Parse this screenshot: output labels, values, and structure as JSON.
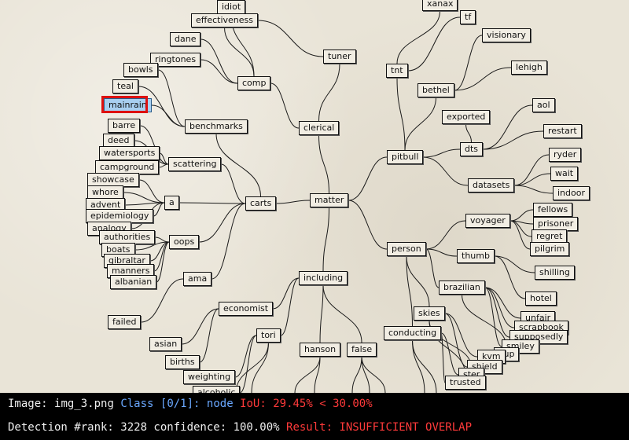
{
  "nodes": [
    {
      "id": "idiot",
      "label": "idiot"
    },
    {
      "id": "effectiveness",
      "label": "effectiveness"
    },
    {
      "id": "dane",
      "label": "dane"
    },
    {
      "id": "ringtones",
      "label": "ringtones"
    },
    {
      "id": "bowls",
      "label": "bowls"
    },
    {
      "id": "comp",
      "label": "comp"
    },
    {
      "id": "teal",
      "label": "teal"
    },
    {
      "id": "mainrain",
      "label": "mainrain",
      "selected": true
    },
    {
      "id": "benchmarks",
      "label": "benchmarks"
    },
    {
      "id": "barre",
      "label": "barre"
    },
    {
      "id": "deed",
      "label": "deed"
    },
    {
      "id": "watersports",
      "label": "watersports"
    },
    {
      "id": "scattering",
      "label": "scattering"
    },
    {
      "id": "campground",
      "label": "campground"
    },
    {
      "id": "showcase",
      "label": "showcase"
    },
    {
      "id": "whore",
      "label": "whore"
    },
    {
      "id": "a",
      "label": "a"
    },
    {
      "id": "advent",
      "label": "advent"
    },
    {
      "id": "epidemiology",
      "label": "epidemiology"
    },
    {
      "id": "analogy",
      "label": "analogy"
    },
    {
      "id": "authorities",
      "label": "authorities"
    },
    {
      "id": "oops",
      "label": "oops"
    },
    {
      "id": "boats",
      "label": "boats"
    },
    {
      "id": "gibraltar",
      "label": "gibraltar"
    },
    {
      "id": "manners",
      "label": "manners"
    },
    {
      "id": "albanian",
      "label": "albanian"
    },
    {
      "id": "ama",
      "label": "ama"
    },
    {
      "id": "failed",
      "label": "failed"
    },
    {
      "id": "carts",
      "label": "carts"
    },
    {
      "id": "clerical",
      "label": "clerical"
    },
    {
      "id": "tuner",
      "label": "tuner"
    },
    {
      "id": "matter",
      "label": "matter"
    },
    {
      "id": "including",
      "label": "including"
    },
    {
      "id": "economist",
      "label": "economist"
    },
    {
      "id": "asian",
      "label": "asian"
    },
    {
      "id": "births",
      "label": "births"
    },
    {
      "id": "weighting",
      "label": "weighting"
    },
    {
      "id": "alcoholic",
      "label": "alcoholic"
    },
    {
      "id": "tori",
      "label": "tori"
    },
    {
      "id": "hanson",
      "label": "hanson"
    },
    {
      "id": "false",
      "label": "false"
    },
    {
      "id": "xanax",
      "label": "xanax"
    },
    {
      "id": "tf",
      "label": "tf"
    },
    {
      "id": "visionary",
      "label": "visionary"
    },
    {
      "id": "tnt",
      "label": "tnt"
    },
    {
      "id": "lehigh",
      "label": "lehigh"
    },
    {
      "id": "bethel",
      "label": "bethel"
    },
    {
      "id": "aol",
      "label": "aol"
    },
    {
      "id": "exported",
      "label": "exported"
    },
    {
      "id": "restart",
      "label": "restart"
    },
    {
      "id": "dts",
      "label": "dts"
    },
    {
      "id": "pitbull",
      "label": "pitbull"
    },
    {
      "id": "ryder",
      "label": "ryder"
    },
    {
      "id": "wait",
      "label": "wait"
    },
    {
      "id": "datasets",
      "label": "datasets"
    },
    {
      "id": "indoor",
      "label": "indoor"
    },
    {
      "id": "fellows",
      "label": "fellows"
    },
    {
      "id": "voyager",
      "label": "voyager"
    },
    {
      "id": "prisoner",
      "label": "prisoner"
    },
    {
      "id": "regret",
      "label": "regret"
    },
    {
      "id": "pilgrim",
      "label": "pilgrim"
    },
    {
      "id": "person",
      "label": "person"
    },
    {
      "id": "thumb",
      "label": "thumb"
    },
    {
      "id": "shilling",
      "label": "shilling"
    },
    {
      "id": "brazilian",
      "label": "brazilian"
    },
    {
      "id": "hotel",
      "label": "hotel"
    },
    {
      "id": "skies",
      "label": "skies"
    },
    {
      "id": "unfair",
      "label": "unfair"
    },
    {
      "id": "scrapbook",
      "label": "scrapbook"
    },
    {
      "id": "supposedly",
      "label": "supposedly"
    },
    {
      "id": "conducting",
      "label": "conducting"
    },
    {
      "id": "smiley",
      "label": "smiley"
    },
    {
      "id": "yup",
      "label": "yup"
    },
    {
      "id": "kvm",
      "label": "kvm"
    },
    {
      "id": "shield",
      "label": "shield"
    },
    {
      "id": "ster",
      "label": "ster"
    },
    {
      "id": "trusted",
      "label": "trusted"
    }
  ],
  "edges": [
    [
      "matter",
      "carts"
    ],
    [
      "matter",
      "clerical"
    ],
    [
      "matter",
      "including"
    ],
    [
      "matter",
      "pitbull"
    ],
    [
      "matter",
      "person"
    ],
    [
      "clerical",
      "comp"
    ],
    [
      "clerical",
      "tuner"
    ],
    [
      "comp",
      "idiot"
    ],
    [
      "comp",
      "effectiveness"
    ],
    [
      "comp",
      "dane"
    ],
    [
      "comp",
      "ringtones"
    ],
    [
      "tuner",
      "effectiveness"
    ],
    [
      "benchmarks",
      "bowls"
    ],
    [
      "benchmarks",
      "teal"
    ],
    [
      "benchmarks",
      "mainrain"
    ],
    [
      "carts",
      "benchmarks"
    ],
    [
      "carts",
      "scattering"
    ],
    [
      "carts",
      "a"
    ],
    [
      "carts",
      "oops"
    ],
    [
      "carts",
      "ama"
    ],
    [
      "scattering",
      "barre"
    ],
    [
      "scattering",
      "deed"
    ],
    [
      "scattering",
      "watersports"
    ],
    [
      "scattering",
      "campground"
    ],
    [
      "a",
      "showcase"
    ],
    [
      "a",
      "whore"
    ],
    [
      "a",
      "advent"
    ],
    [
      "a",
      "epidemiology"
    ],
    [
      "a",
      "analogy"
    ],
    [
      "oops",
      "authorities"
    ],
    [
      "oops",
      "boats"
    ],
    [
      "oops",
      "gibraltar"
    ],
    [
      "oops",
      "manners"
    ],
    [
      "oops",
      "albanian"
    ],
    [
      "ama",
      "failed"
    ],
    [
      "including",
      "economist"
    ],
    [
      "including",
      "tori"
    ],
    [
      "including",
      "hanson"
    ],
    [
      "including",
      "false"
    ],
    [
      "economist",
      "asian"
    ],
    [
      "economist",
      "births"
    ],
    [
      "tori",
      "weighting"
    ],
    [
      "tori",
      "alcoholic"
    ],
    [
      "pitbull",
      "tnt"
    ],
    [
      "pitbull",
      "bethel"
    ],
    [
      "pitbull",
      "dts"
    ],
    [
      "pitbull",
      "datasets"
    ],
    [
      "tnt",
      "xanax"
    ],
    [
      "tnt",
      "tf"
    ],
    [
      "bethel",
      "visionary"
    ],
    [
      "bethel",
      "lehigh"
    ],
    [
      "dts",
      "aol"
    ],
    [
      "dts",
      "exported"
    ],
    [
      "dts",
      "restart"
    ],
    [
      "datasets",
      "ryder"
    ],
    [
      "datasets",
      "wait"
    ],
    [
      "datasets",
      "indoor"
    ],
    [
      "person",
      "voyager"
    ],
    [
      "person",
      "thumb"
    ],
    [
      "person",
      "brazilian"
    ],
    [
      "person",
      "skies"
    ],
    [
      "person",
      "conducting"
    ],
    [
      "voyager",
      "fellows"
    ],
    [
      "voyager",
      "prisoner"
    ],
    [
      "voyager",
      "regret"
    ],
    [
      "voyager",
      "pilgrim"
    ],
    [
      "thumb",
      "shilling"
    ],
    [
      "thumb",
      "hotel"
    ],
    [
      "brazilian",
      "unfair"
    ],
    [
      "brazilian",
      "scrapbook"
    ],
    [
      "brazilian",
      "supposedly"
    ],
    [
      "brazilian",
      "smiley"
    ],
    [
      "brazilian",
      "yup"
    ],
    [
      "skies",
      "kvm"
    ],
    [
      "skies",
      "shield"
    ],
    [
      "skies",
      "ster"
    ],
    [
      "skies",
      "trusted"
    ],
    [
      "conducting",
      "trusted"
    ],
    [
      "conducting",
      "ster"
    ]
  ],
  "status": {
    "image_label": "Image:",
    "image_name": "img_3.png",
    "class_label": "Class [0/1]:",
    "class_value": "node",
    "iou_text": "IoU: 29.45% < 30.00%",
    "rank_text": "Detection #rank: 3228 confidence: 100.00%",
    "result_text": "Result: INSUFFICIENT OVERLAP"
  },
  "colors": {
    "highlight_box": "#dd1111",
    "selected_fill": "#a8cff0",
    "status_blue": "#6aa8ff",
    "status_red": "#ff3a3a"
  }
}
